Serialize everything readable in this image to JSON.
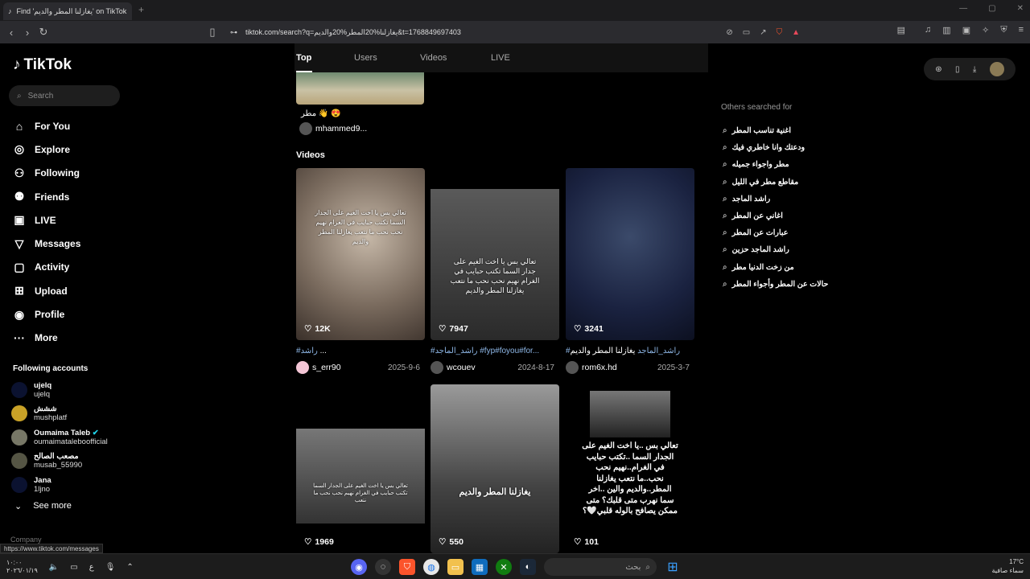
{
  "browser": {
    "tab_title": "Find 'يغازلنا المطر والديم' on TikTok",
    "tab_close": "×",
    "new_tab": "+",
    "url": "tiktok.com/search?q=يغازلنا%20المطر%20والديم&t=1768849697403",
    "status_url": "https://www.tiktok.com/messages"
  },
  "sidebar": {
    "logo": "TikTok",
    "search_placeholder": "Search",
    "nav": [
      {
        "label": "For You",
        "icon": "home-icon",
        "glyph": "⌂"
      },
      {
        "label": "Explore",
        "icon": "compass-icon",
        "glyph": "◎"
      },
      {
        "label": "Following",
        "icon": "following-icon",
        "glyph": "⚇"
      },
      {
        "label": "Friends",
        "icon": "friends-icon",
        "glyph": "⚉"
      },
      {
        "label": "LIVE",
        "icon": "live-icon",
        "glyph": "▣"
      },
      {
        "label": "Messages",
        "icon": "messages-icon",
        "glyph": "▽"
      },
      {
        "label": "Activity",
        "icon": "activity-icon",
        "glyph": "▢"
      },
      {
        "label": "Upload",
        "icon": "upload-icon",
        "glyph": "⊞"
      },
      {
        "label": "Profile",
        "icon": "profile-icon",
        "glyph": "◉"
      },
      {
        "label": "More",
        "icon": "more-icon",
        "glyph": "···"
      }
    ],
    "following_header": "Following accounts",
    "accounts": [
      {
        "name": "ujelq",
        "handle": "ujelq"
      },
      {
        "name": "ششش",
        "handle": "mushplatf"
      },
      {
        "name": "Oumaima Taleb",
        "handle": "oumaimataleboofficial"
      },
      {
        "name": "مصعب الصالح",
        "handle": "musab_55990"
      },
      {
        "name": "Jana",
        "handle": "1ljno"
      }
    ],
    "see_more": "See more",
    "company": "Company"
  },
  "main": {
    "tabs": [
      "Top",
      "Users",
      "Videos",
      "LIVE"
    ],
    "top_caption": "مطر 👋 😍",
    "top_user": "mhammed9...",
    "videos_header": "Videos",
    "videos": [
      {
        "likes": "12K",
        "caption_tag": "#راشد",
        "caption_rest": " ...",
        "user": "s_err90",
        "date": "2025-9-6",
        "overlay": "تعالي بس يا اخت الغيم على الجدار السما تكتب حبايب في الغرام نهيم نحب نحب ما نتعب يغازلنا المطر والديم"
      },
      {
        "likes": "7947",
        "caption_tag": "#راشد_الماجد #fyp#foyou#for...",
        "caption_rest": "",
        "user": "wcouev",
        "date": "2024-8-17",
        "overlay": "تعالي بس يا اخت الغيم على جدار السما تكتب حبايب في الغرام نهيم نحب نحب ما نتعب يغازلنا المطر والديم"
      },
      {
        "likes": "3241",
        "caption_tag": "#راشد_الماجد",
        "caption_rest": " يغازلنا المطر والديم",
        "user": "rom6x.hd",
        "date": "2025-3-7",
        "overlay": ""
      },
      {
        "likes": "1969",
        "caption_tag": "",
        "caption_rest": "",
        "user": "",
        "date": "",
        "overlay": "تعالي بس يا اخت الغيم على الجدار السما تكتب حبايب في الغرام نهيم نحب نحب ما نتعب"
      },
      {
        "likes": "550",
        "caption_tag": "",
        "caption_rest": "",
        "user": "",
        "date": "",
        "overlay": "يغازلنا المطر والديم"
      },
      {
        "likes": "101",
        "caption_tag": "",
        "caption_rest": "",
        "user": "",
        "date": "",
        "overlay": "تعالي بس ..يا اخت الغيم على الجدار السما ..تكتب حبايب في الغرام..نهيم نحب نحب..ما نتعب يغازلنا المطر..والديم والين ..اخر سما نهرب متى قلبك؟ متى ممكن يصافح بالوله قلبي🤍؟"
      }
    ]
  },
  "right": {
    "others_header": "Others searched for",
    "suggestions": [
      "اغنية تناسب المطر",
      "ودعتك وانا خاطري فيك",
      "مطر واجواء جميله",
      "مقاطع مطر في الليل",
      "راشد الماجد",
      "اغاني عن المطر",
      "عبارات عن المطر",
      "راشد الماجد حزين",
      "من زخت الدنيا مطر",
      "حالات عن المطر وأجواء المطر"
    ]
  },
  "taskbar": {
    "time": "١٠:٠٠",
    "date": "٢٠٢٦/٠١/١٩",
    "lang": "ع",
    "search_placeholder": "بحث",
    "weather_temp": "17°C",
    "weather_desc": "سماء صافية"
  },
  "colors": {
    "accent": "#fe2c55",
    "tag": "#8fb8e8"
  }
}
